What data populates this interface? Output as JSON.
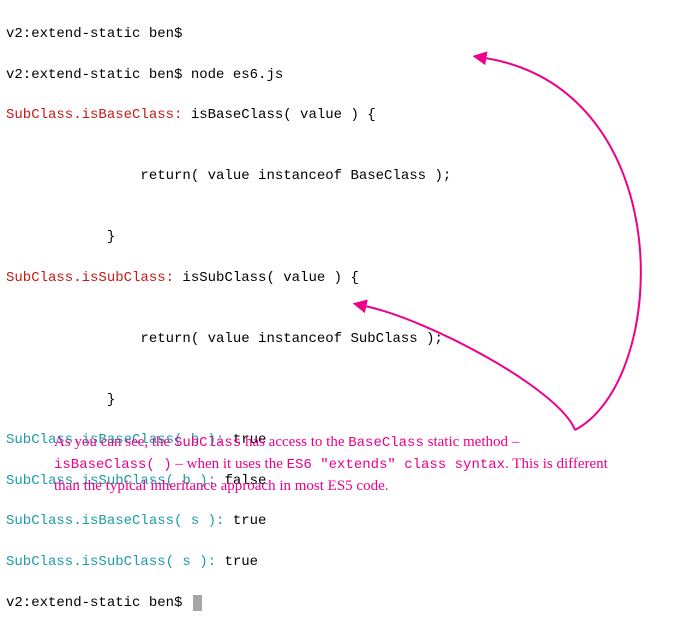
{
  "term": {
    "l1_prompt": "v2:extend-static ben$",
    "l2_prompt": "v2:extend-static ben$",
    "l2_cmd": " node es6.js",
    "l3_label": "SubClass.isBaseClass:",
    "l3_code": " isBaseClass( value ) {",
    "l4": "",
    "l5": "                return( value instanceof BaseClass );",
    "l6": "",
    "l7": "            }",
    "l8_label": "SubClass.isSubClass:",
    "l8_code": " isSubClass( value ) {",
    "l9": "",
    "l10": "                return( value instanceof SubClass );",
    "l11": "",
    "l12": "            }",
    "r1_call": "SubClass.isBaseClass( b ):",
    "r1_val": " true",
    "r2_call": "SubClass.isSubClass( b ):",
    "r2_val": " false",
    "r3_call": "SubClass.isBaseClass( s ):",
    "r3_val": " true",
    "r4_call": "SubClass.isSubClass( s ):",
    "r4_val": " true",
    "end_prompt": "v2:extend-static ben$ "
  },
  "note": {
    "t1": "As you can see, the ",
    "t2": "SubClass",
    "t3": " has access to the ",
    "t4": "BaseClass",
    "t5": " static method – ",
    "t6": "isBaseClass( )",
    "t7": "  – when it uses the ",
    "t8": "ES6 \"extends\" class syntax",
    "t9": ". This is different than the typical inheritance approach in most ES5 code."
  },
  "colors": {
    "arrow": "#ec008c"
  }
}
